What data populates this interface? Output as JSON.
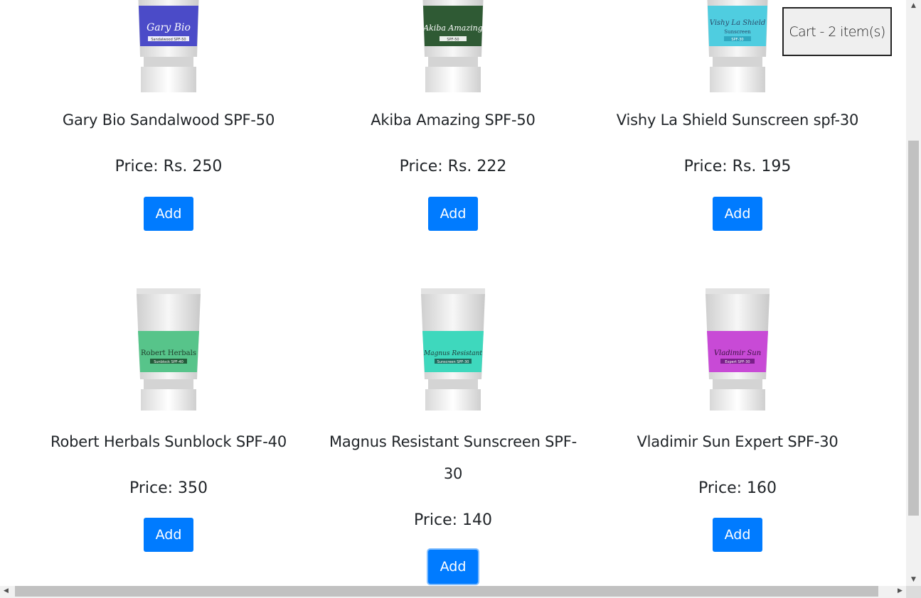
{
  "cart": {
    "label": "Cart - 2 item(s)"
  },
  "products": [
    {
      "name": "Gary Bio Sandalwood SPF-50",
      "price": "Price: Rs. 250",
      "add": "Add",
      "tube_brand": "Gary Bio",
      "tube_sub": "Sandalwood SPF-50",
      "tube_sub2": "",
      "color": "#4b4bc8"
    },
    {
      "name": "Akiba Amazing SPF-50",
      "price": "Price: Rs. 222",
      "add": "Add",
      "tube_brand": "Akiba Amazing",
      "tube_sub": "SPF-50",
      "tube_sub2": "",
      "color": "#2f5a34"
    },
    {
      "name": "Vishy La Shield Sunscreen spf-30",
      "price": "Price: Rs. 195",
      "add": "Add",
      "tube_brand": "Vishy La Shield",
      "tube_sub": "Sunscreen",
      "tube_sub2": "SPF-30",
      "color": "#4fcde0"
    },
    {
      "name": "Robert Herbals Sunblock SPF-40",
      "price": "Price: 350",
      "add": "Add",
      "tube_brand": "Robert Herbals",
      "tube_sub": "Sunblock SPF-40",
      "tube_sub2": "",
      "color": "#57c48a"
    },
    {
      "name": "Magnus Resistant Sunscreen SPF-30",
      "price": "Price: 140",
      "add": "Add",
      "tube_brand": "Magnus Resistant",
      "tube_sub": "Sunscreen SPF-30",
      "tube_sub2": "",
      "color": "#3ed8bd"
    },
    {
      "name": "Vladimir Sun Expert SPF-30",
      "price": "Price: 160",
      "add": "Add",
      "tube_brand": "Vladimir Sun",
      "tube_sub": "Expert SPF-30",
      "tube_sub2": "",
      "color": "#c84ad6"
    }
  ]
}
